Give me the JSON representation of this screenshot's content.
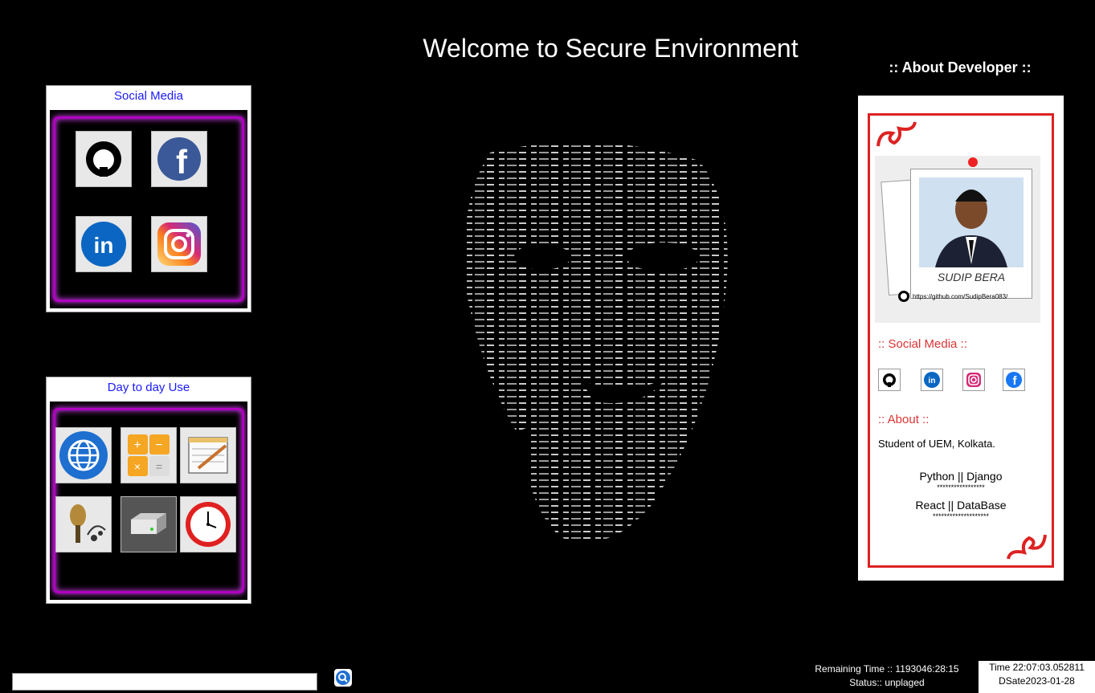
{
  "header": {
    "title": "Welcome to Secure Environment"
  },
  "social_panel": {
    "title": "Social Media",
    "icons": [
      "github-icon",
      "facebook-icon",
      "linkedin-icon",
      "instagram-icon"
    ]
  },
  "daily_panel": {
    "title": "Day to day Use",
    "icons": [
      "browser-icon",
      "calculator-icon",
      "notepad-icon",
      "music-icon",
      "drive-icon",
      "clock-icon"
    ]
  },
  "about_developer": {
    "heading": ":: About Developer ::",
    "photo_name": "SUDIP BERA",
    "photo_link": "https://github.com/SudipBera083/",
    "social_heading": ":: Social Media ::",
    "about_heading": ":: About ::",
    "bio": "Student of UEM, Kolkata.",
    "skills_line1": "Python || Django",
    "stars1": "*****************",
    "skills_line2": "React ||  DataBase",
    "stars2": "********************"
  },
  "footer": {
    "search_value": "",
    "remaining_time": "Remaining Time :: 1193046:28:15",
    "status": "Status:: unplaged",
    "time": "Time 22:07:03.052811",
    "date": "DSate2023-01-28"
  },
  "colors": {
    "panel_title": "#1a1aff",
    "accent_red": "#dd2222",
    "neon": "#b000c0"
  }
}
